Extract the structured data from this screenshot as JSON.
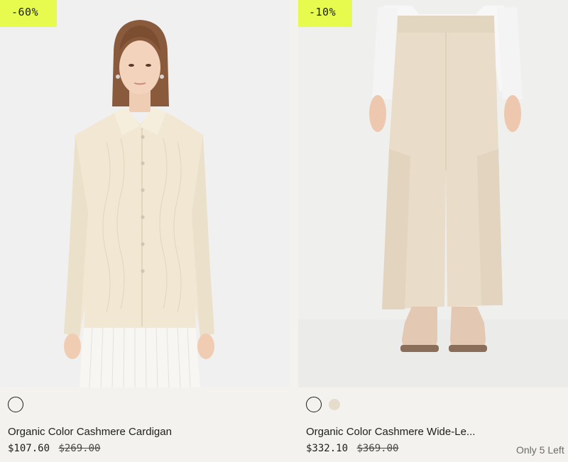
{
  "products": [
    {
      "discount_badge": "-60%",
      "title": "Organic Color Cashmere Cardigan",
      "sale_price": "$107.60",
      "original_price": "$269.00",
      "colors": [
        {
          "name": "ivory",
          "hex": "#f3f2ee",
          "selected": true
        }
      ]
    },
    {
      "discount_badge": "-10%",
      "title": "Organic Color Cashmere Wide-Le...",
      "sale_price": "$332.10",
      "original_price": "$369.00",
      "stock_note": "Only 5 Left",
      "colors": [
        {
          "name": "ivory",
          "hex": "#f3f2ee",
          "selected": true
        },
        {
          "name": "oatmeal",
          "hex": "#e5dccb",
          "selected": false
        }
      ]
    }
  ],
  "theme": {
    "badge_color": "#e6fb4d",
    "page_bg": "#f3f2ee",
    "text_color": "#1d1d1b"
  }
}
